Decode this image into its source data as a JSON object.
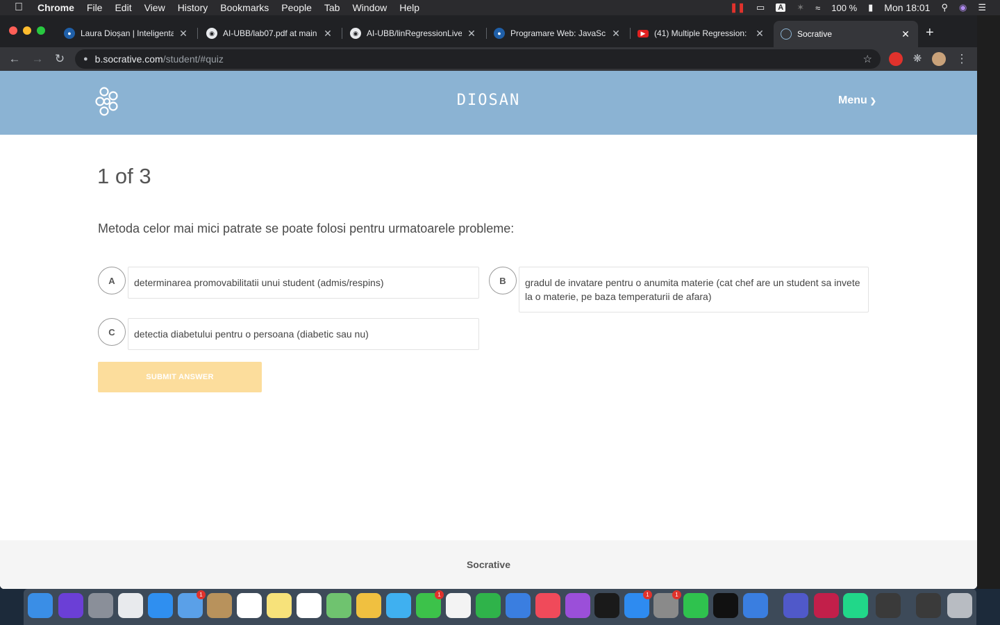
{
  "menubar": {
    "app": "Chrome",
    "items": [
      "File",
      "Edit",
      "View",
      "History",
      "Bookmarks",
      "People",
      "Tab",
      "Window",
      "Help"
    ],
    "battery": "100 %",
    "clock": "Mon 18:01",
    "input_source": "A"
  },
  "tabs": [
    {
      "title": "Laura Dioșan | Inteligenta",
      "icon": "globe-icon",
      "color": "#1f5fa8"
    },
    {
      "title": "AI-UBB/lab07.pdf at main",
      "icon": "github-icon",
      "color": "#e8eaed"
    },
    {
      "title": "AI-UBB/linRegressionLive",
      "icon": "github-icon",
      "color": "#e8eaed"
    },
    {
      "title": "Programare Web: JavaSc",
      "icon": "globe-icon",
      "color": "#1f5fa8"
    },
    {
      "title": "(41) Multiple Regression:",
      "icon": "youtube-icon",
      "color": "#e02020"
    },
    {
      "title": "Socrative",
      "icon": "socrative-icon",
      "color": "#8bb3d3"
    }
  ],
  "address": {
    "host": "b.socrative.com",
    "path": "/student/#quiz"
  },
  "header": {
    "room_name": "DIOSAN",
    "menu_label": "Menu",
    "color": "#8bb3d3"
  },
  "quiz": {
    "progress": "1 of 3",
    "question": "Metoda celor mai mici patrate se poate folosi pentru urmatoarele probleme:",
    "options": [
      {
        "letter": "A",
        "text": "determinarea promovabilitatii unui student (admis/respins)"
      },
      {
        "letter": "B",
        "text": "gradul de invatare pentru o anumita materie (cat chef are un student sa invete la o materie, pe baza temperaturii de afara)"
      },
      {
        "letter": "C",
        "text": "detectia diabetului pentru o persoana (diabetic sau nu)"
      }
    ],
    "submit_label": "SUBMIT ANSWER",
    "submit_color": "#fcdd9c"
  },
  "footer": {
    "brand": "Socrative"
  },
  "dock": {
    "apps": [
      {
        "name": "finder-icon",
        "color": "#3a8ee6"
      },
      {
        "name": "siri-icon",
        "color": "#6b3fd6"
      },
      {
        "name": "launchpad-icon",
        "color": "#8a8f99"
      },
      {
        "name": "chrome-icon",
        "color": "#e8eaed"
      },
      {
        "name": "safari-icon",
        "color": "#2f8ff0"
      },
      {
        "name": "mail-icon",
        "color": "#5aa0e8",
        "badge": "1"
      },
      {
        "name": "contacts-icon",
        "color": "#b8925c"
      },
      {
        "name": "calendar-icon",
        "color": "#ffffff"
      },
      {
        "name": "notes-icon",
        "color": "#f7e27a"
      },
      {
        "name": "reminders-icon",
        "color": "#ffffff"
      },
      {
        "name": "maps-icon",
        "color": "#6fc36f"
      },
      {
        "name": "photos-icon",
        "color": "#f0c040"
      },
      {
        "name": "messages-icon",
        "color": "#3fb0f0"
      },
      {
        "name": "facetime-icon",
        "color": "#3cc24a",
        "badge": "1"
      },
      {
        "name": "freeform-icon",
        "color": "#f3f3f3"
      },
      {
        "name": "numbers-icon",
        "color": "#2fb34a"
      },
      {
        "name": "keynote-icon",
        "color": "#3a7ee0"
      },
      {
        "name": "music-icon",
        "color": "#f04a5a"
      },
      {
        "name": "podcasts-icon",
        "color": "#9b4fd9"
      },
      {
        "name": "tv-icon",
        "color": "#1a1a1a"
      },
      {
        "name": "appstore-icon",
        "color": "#2e8bf0",
        "badge": "1"
      },
      {
        "name": "system-preferences-icon",
        "color": "#8a8a8a",
        "badge": "1"
      },
      {
        "name": "whatsapp-icon",
        "color": "#2fc24e"
      },
      {
        "name": "terminal-icon",
        "color": "#111111"
      },
      {
        "name": "parallels-icon",
        "color": "#3a7ee0"
      },
      {
        "name": "teams-icon",
        "color": "#5059c9"
      },
      {
        "name": "rider-icon",
        "color": "#c21f4a"
      },
      {
        "name": "pycharm-icon",
        "color": "#21d789"
      },
      {
        "name": "screen-sharing-icon",
        "color": "#3a3a3a"
      },
      {
        "name": "mission-control-icon",
        "color": "#3a3a3a"
      },
      {
        "name": "trash-icon",
        "color": "#b8bcc2"
      }
    ]
  }
}
